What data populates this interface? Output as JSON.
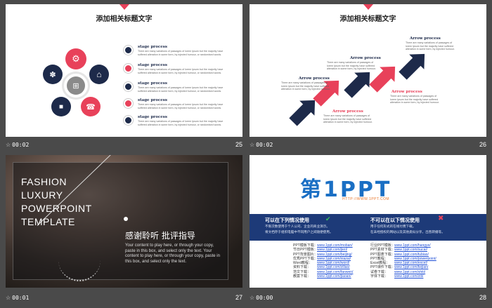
{
  "slides": [
    {
      "time": "00:02",
      "number": "25",
      "title": "添加相关标题文字",
      "stages": [
        {
          "title": "stage process",
          "text": "There are many variations of passages of lorem Ipsum but the majority have suffered alteration in some form, by injected humour, or randomised words.",
          "color": "#1d2a4a"
        },
        {
          "title": "stage process",
          "text": "There are many variations of passages of lorem Ipsum but the majority have suffered alteration in some form, by injected humour, or randomised words.",
          "color": "#e8415a"
        },
        {
          "title": "stage process",
          "text": "There are many variations of passages of lorem Ipsum but the majority have suffered alteration in some form, by injected humour, or randomised words.",
          "color": "#1d2a4a"
        },
        {
          "title": "stage process",
          "text": "There are many variations of passages of lorem Ipsum but the majority have suffered alteration in some form, by injected humour, or randomised words.",
          "color": "#e8415a"
        },
        {
          "title": "stage process",
          "text": "There are many variations of passages of lorem Ipsum but the majority have suffered alteration in some form, by injected humour, or randomised words.",
          "color": "#1d2a4a"
        }
      ]
    },
    {
      "time": "00:02",
      "number": "26",
      "title": "添加相关标题文字",
      "arrows": [
        {
          "label": "Arrow process",
          "text": "There are many variations of passages of lorem Ipsum but the majority have suffered alteration in some form, by injected humour.",
          "color": "#1d2a4a"
        },
        {
          "label": "Arrow process",
          "text": "There are many variations of passages of lorem Ipsum but the majority have suffered alteration in some form, by injected humour.",
          "color": "#e8415a"
        },
        {
          "label": "Arrow process",
          "text": "There are many variations of passages of lorem Ipsum but the majority have suffered alteration in some form, by injected humour.",
          "color": "#1d2a4a"
        },
        {
          "label": "Arrow process",
          "text": "There are many variations of passages of lorem Ipsum but the majority have suffered alteration in some form, by injected humour.",
          "color": "#e8415a"
        },
        {
          "label": "Arrow process",
          "text": "There are many variations of passages of lorem Ipsum but the majority have suffered alteration in some form, by injected humour.",
          "color": "#1d2a4a"
        }
      ]
    },
    {
      "time": "00:01",
      "number": "27",
      "heading_lines": [
        "FASHION",
        "LUXURY",
        "POWERPOINT",
        "TEMPLATE"
      ],
      "thanks": "感谢聆听 批评指导",
      "body": "Your content to play here, or through your copy, paste in this box, and select only the text. Your content to play here, or through your copy, paste in this box, and select only the text."
    },
    {
      "time": "00:00",
      "number": "28",
      "logo": "第1PPT",
      "logo_url": "HTTP://WWW.1PPT.COM",
      "can_use_title": "可以在下列情况使用",
      "can_use_lines": [
        "不限次数使用于个人公司、企业的商业演示。",
        "将文档存于组织电脑中不同用户之间随便使用。"
      ],
      "cannot_use_title": "不可以在以下情况使用",
      "cannot_use_lines": [
        "用于任何形式的在线付费下载。",
        "在未经授权的网站以及其他类似分享，出售转播等。"
      ],
      "links_left": [
        {
          "label": "PPT模板下载：",
          "url": "www.1ppt.com/moban/"
        },
        {
          "label": "节日PPT模板：",
          "url": "www.1ppt.com/jieri/"
        },
        {
          "label": "PPT背景图片：",
          "url": "www.1ppt.com/beijing/"
        },
        {
          "label": "优秀PPT下载：",
          "url": "www.1ppt.com/xiazai/"
        },
        {
          "label": "Word教程：",
          "url": "www.1ppt.com/word/"
        },
        {
          "label": "资料下载：",
          "url": "www.1ppt.com/ziliao/"
        },
        {
          "label": "范文下载：",
          "url": "www.1ppt.com/fanwen/"
        },
        {
          "label": "教案下载：",
          "url": "www.1ppt.com/jiaoan/"
        }
      ],
      "links_right": [
        {
          "label": "行业PPT模板：",
          "url": "www.1ppt.com/hangye/"
        },
        {
          "label": "PPT素材下载：",
          "url": "www.1ppt.com/sucai/"
        },
        {
          "label": "PPT图表下载：",
          "url": "www.1ppt.com/tubiao/"
        },
        {
          "label": "PPT教程：",
          "url": "www.1ppt.com/powerpoint/"
        },
        {
          "label": "Excel教程：",
          "url": "www.1ppt.com/excel/"
        },
        {
          "label": "PPT课件下载：",
          "url": "www.1ppt.com/kejian/"
        },
        {
          "label": "试卷下载：",
          "url": "www.1ppt.com/shiti/"
        },
        {
          "label": "字体下载：",
          "url": "www.1ppt.com/ziti/"
        }
      ]
    }
  ]
}
